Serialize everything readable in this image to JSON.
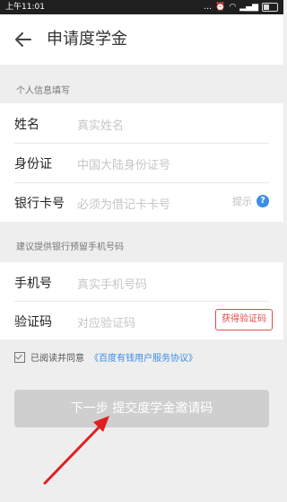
{
  "status_bar": {
    "time": "上午11:01",
    "icons": [
      "more-icon",
      "alarm-icon",
      "wifi-icon",
      "signal-icon",
      "battery-icon"
    ]
  },
  "header": {
    "title": "申请度学金",
    "back_icon": "back-arrow-icon"
  },
  "personal_section": {
    "heading": "个人信息填写",
    "fields": [
      {
        "label": "姓名",
        "placeholder": "真实姓名"
      },
      {
        "label": "身份证",
        "placeholder": "中国大陆身份证号"
      },
      {
        "label": "银行卡号",
        "placeholder": "必须为借记卡卡号",
        "hint": "提示",
        "hint_icon": "help-icon"
      }
    ]
  },
  "phone_section": {
    "heading": "建议提供银行预留手机号码",
    "fields": [
      {
        "label": "手机号",
        "placeholder": "真实手机号码"
      },
      {
        "label": "验证码",
        "placeholder": "对应验证码",
        "button_label": "获得验证码"
      }
    ]
  },
  "agreement": {
    "text": "已阅读并同意",
    "link": "《百度有钱用户服务协议》",
    "checked": true
  },
  "submit": {
    "label": "下一步 提交度学金邀请码"
  },
  "colors": {
    "accent_blue": "#3a8ee6",
    "accent_red": "#e34a4a",
    "disabled_button": "#cfcfcf",
    "annotation_arrow": "#e02020"
  }
}
